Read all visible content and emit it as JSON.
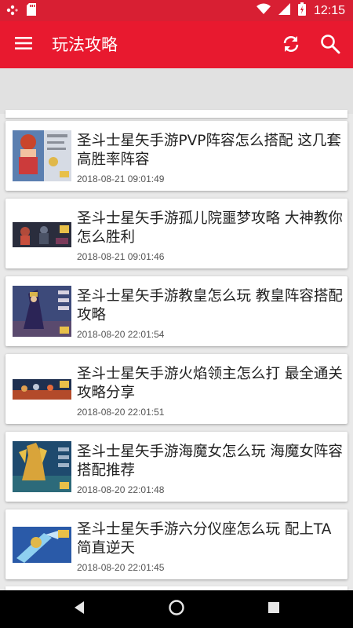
{
  "status_bar": {
    "time": "12:15",
    "icons": [
      "notification-dots-icon",
      "sd-card-icon",
      "wifi-icon",
      "signal-icon",
      "battery-icon"
    ]
  },
  "app_bar": {
    "title": "玩法攻略",
    "menu_icon": "hamburger-menu-icon",
    "refresh_icon": "refresh-icon",
    "search_icon": "search-icon"
  },
  "articles": [
    {
      "title": "圣斗士星矢手游PVP阵容怎么搭配 这几套高胜率阵容",
      "date": "2018-08-21 09:01:49",
      "thumb": "character-portrait"
    },
    {
      "title": "圣斗士星矢手游孤儿院噩梦攻略 大神教你怎么胜利",
      "date": "2018-08-21 09:01:46",
      "thumb": "dark-scene"
    },
    {
      "title": "圣斗士星矢手游教皇怎么玩 教皇阵容搭配攻略",
      "date": "2018-08-20 22:01:54",
      "thumb": "pope-character"
    },
    {
      "title": "圣斗士星矢手游火焰领主怎么打 最全通关攻略分享",
      "date": "2018-08-20 22:01:51",
      "thumb": "fire-battle"
    },
    {
      "title": "圣斗士星矢手游海魔女怎么玩 海魔女阵容搭配推荐",
      "date": "2018-08-20 22:01:48",
      "thumb": "golden-warrior"
    },
    {
      "title": "圣斗士星矢手游六分仪座怎么玩 配上TA简直逆天",
      "date": "2018-08-20 22:01:45",
      "thumb": "blue-action"
    }
  ],
  "nav_bar": {
    "icons": [
      "back-icon",
      "home-icon",
      "recents-icon"
    ]
  },
  "colors": {
    "status_bar": "#d81f33",
    "app_bar": "#e8192f",
    "background": "#e9e9e9",
    "card": "#ffffff"
  }
}
